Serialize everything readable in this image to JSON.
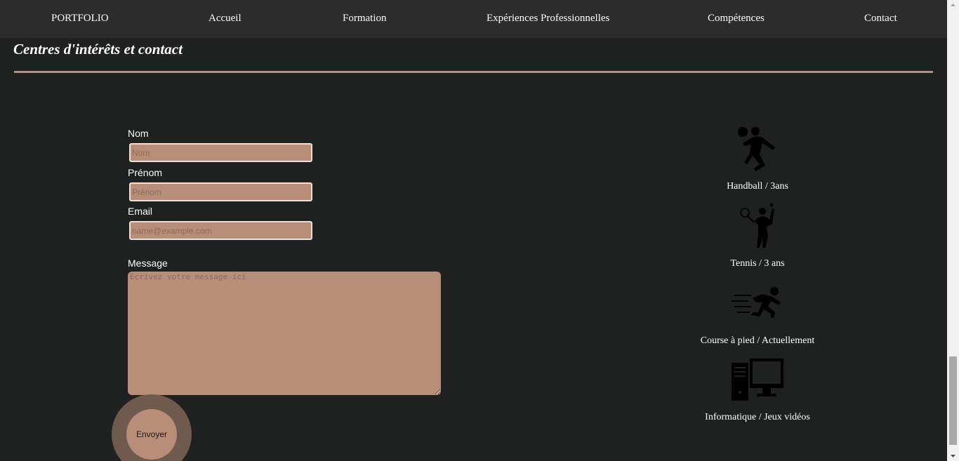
{
  "nav": {
    "brand": "PORTFOLIO",
    "items": [
      {
        "label": "Accueil"
      },
      {
        "label": "Formation"
      },
      {
        "label": "Expériences Professionnelles"
      },
      {
        "label": "Compétences"
      },
      {
        "label": "Contact"
      }
    ]
  },
  "section": {
    "title": "Centres d'intérêts et contact"
  },
  "form": {
    "nom_label": "Nom",
    "nom_placeholder": "Nom",
    "prenom_label": "Prénom",
    "prenom_placeholder": "Prénom",
    "email_label": "Email",
    "email_placeholder": "name@example.com",
    "message_label": "Message",
    "message_placeholder": "Ecrivez votre message ici",
    "send_label": "Envoyer"
  },
  "interests": [
    {
      "icon": "handball-player-icon",
      "caption": "Handball / 3ans"
    },
    {
      "icon": "tennis-player-icon",
      "caption": "Tennis / 3 ans"
    },
    {
      "icon": "runner-icon",
      "caption": "Course à pied / Actuellement"
    },
    {
      "icon": "desktop-computer-icon",
      "caption": "Informatique / Jeux vidéos"
    }
  ],
  "colors": {
    "background": "#1f2121",
    "navbar": "#2c2c2c",
    "accent": "#b98e79",
    "button_ring": "#705a4e"
  }
}
